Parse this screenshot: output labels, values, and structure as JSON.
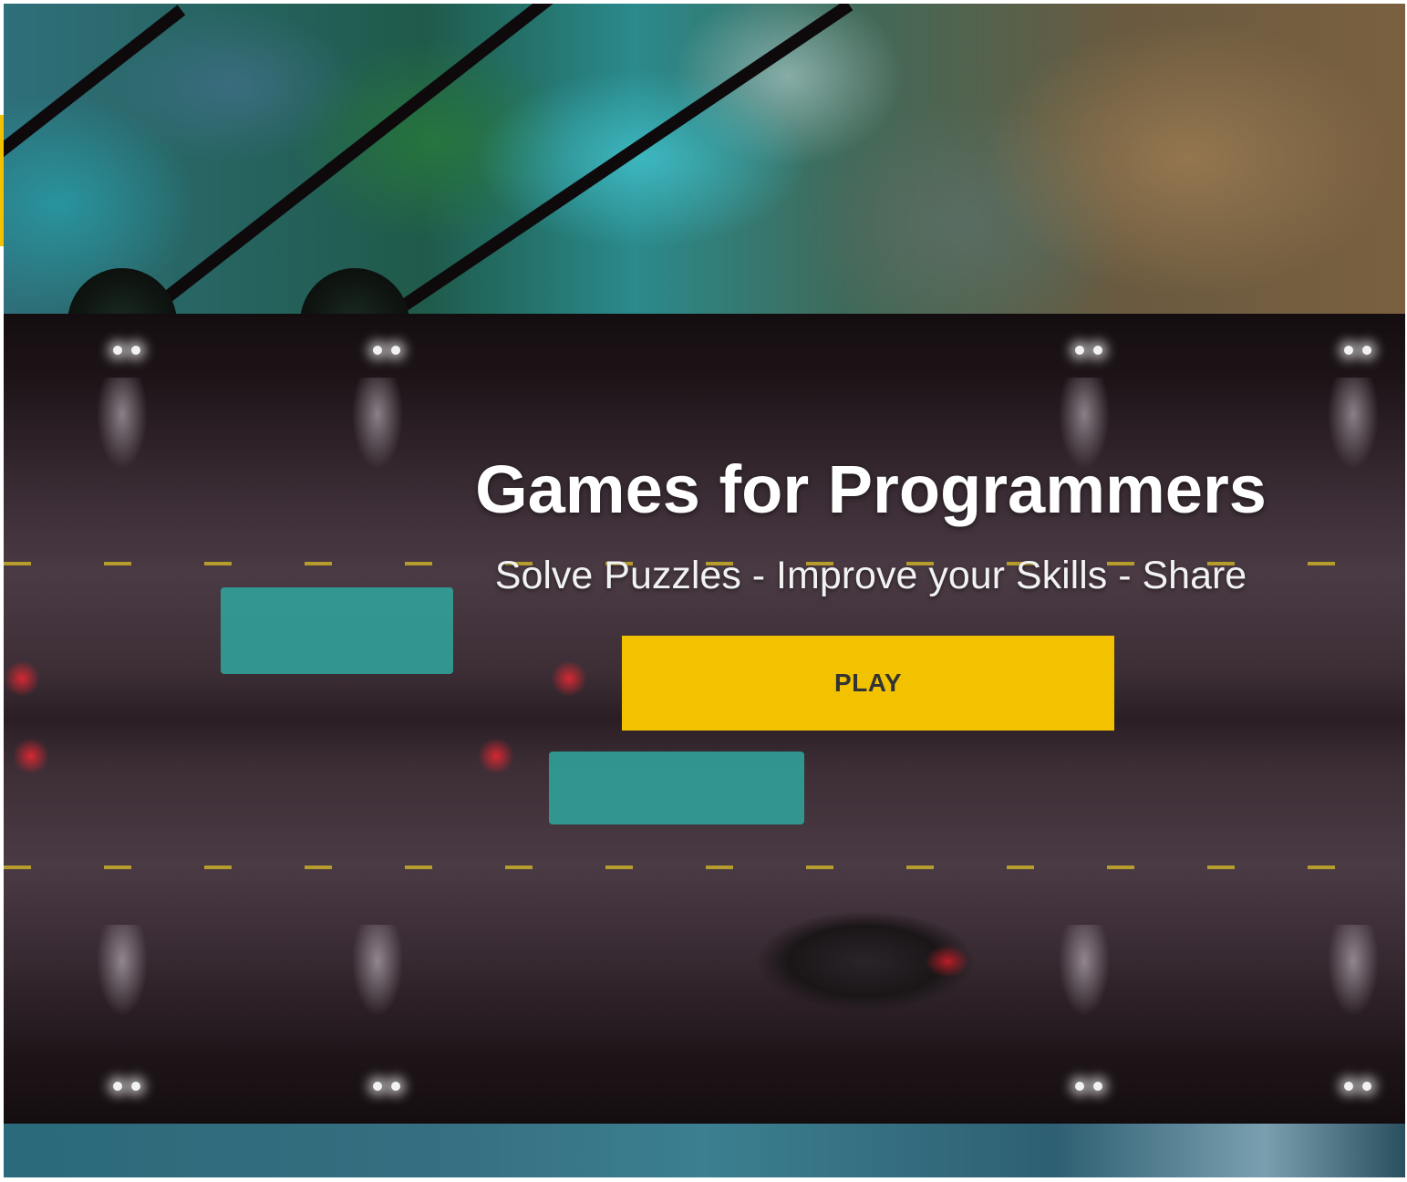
{
  "hero": {
    "title": "Games for Programmers",
    "subtitle": "Solve Puzzles - Improve your Skills - Share",
    "play_label": "PLAY"
  },
  "colors": {
    "accent": "#f2c200",
    "title_text": "#ffffff",
    "button_text": "#333333"
  }
}
